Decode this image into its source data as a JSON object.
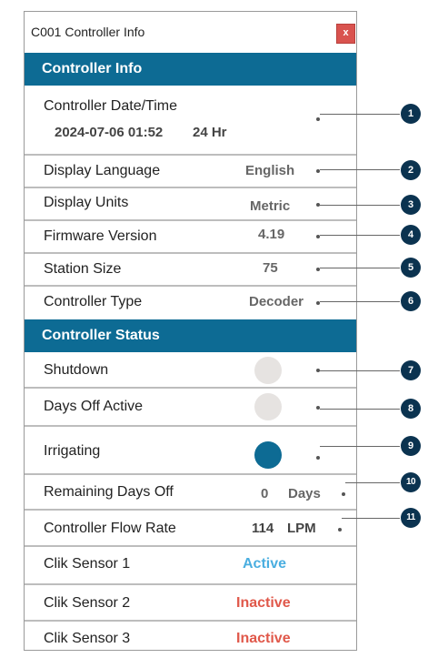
{
  "window": {
    "title": "C001 Controller Info",
    "close_label": "x"
  },
  "info_section": {
    "header": "Controller Info",
    "datetime": {
      "label": "Controller Date/Time",
      "value": "2024-07-06 01:52",
      "format": "24 Hr",
      "callout": "1"
    },
    "language": {
      "label": "Display Language",
      "value": "English",
      "callout": "2"
    },
    "units": {
      "label": "Display Units",
      "value": "Metric",
      "callout": "3"
    },
    "firmware": {
      "label": "Firmware Version",
      "value": "4.19",
      "callout": "4"
    },
    "station_size": {
      "label": "Station Size",
      "value": "75",
      "callout": "5"
    },
    "controller_type": {
      "label": "Controller Type",
      "value": "Decoder",
      "callout": "6"
    }
  },
  "status_section": {
    "header": "Controller Status",
    "shutdown": {
      "label": "Shutdown",
      "active": false,
      "callout": "7"
    },
    "days_off_active": {
      "label": "Days Off Active",
      "active": false,
      "callout": "8"
    },
    "irrigating": {
      "label": "Irrigating",
      "active": true,
      "callout": "9"
    },
    "remaining_days_off": {
      "label": "Remaining Days Off",
      "value": "0",
      "unit": "Days",
      "callout": "10"
    },
    "flow_rate": {
      "label": "Controller Flow Rate",
      "value": "114",
      "unit": "LPM",
      "callout": "11"
    },
    "clik_sensors": [
      {
        "label": "Clik Sensor 1",
        "status": "Active"
      },
      {
        "label": "Clik Sensor 2",
        "status": "Inactive"
      },
      {
        "label": "Clik Sensor 3",
        "status": "Inactive"
      }
    ]
  },
  "colors": {
    "header_blue": "#0d6b94",
    "callout_navy": "#0b3350",
    "active": "#4aaee0",
    "inactive": "#e0584a",
    "indicator_off": "#e6e3e1"
  }
}
